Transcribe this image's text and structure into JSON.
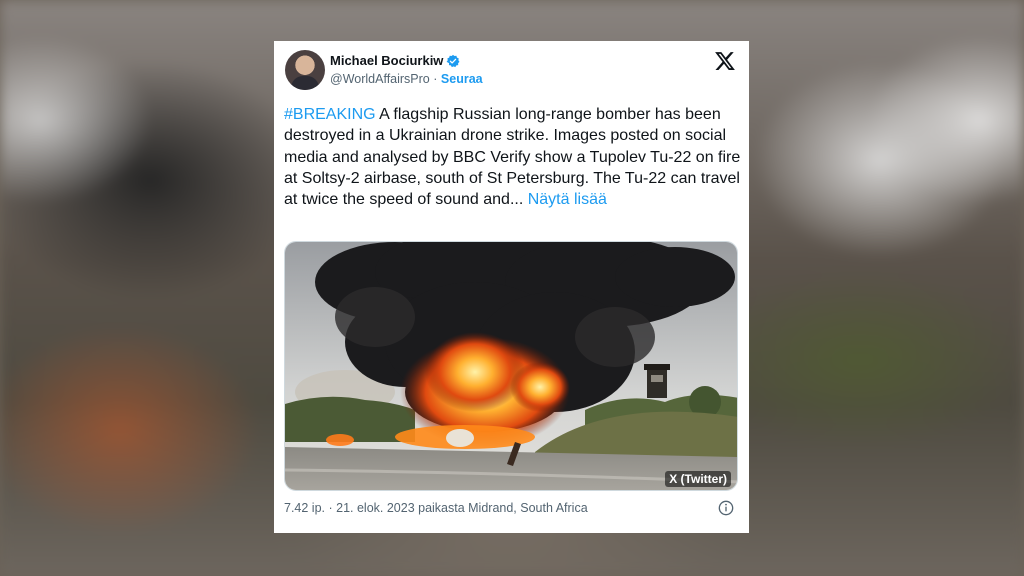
{
  "tweet": {
    "author_name": "Michael Bociurkiw",
    "handle": "@WorldAffairsPro",
    "separator": "·",
    "follow_label": "Seuraa",
    "hashtag": "#BREAKING",
    "body": " A flagship Russian long-range bomber has been destroyed in a Ukrainian drone strike. Images posted on social media and analysed by BBC Verify show a Tupolev Tu-22 on fire at Soltsy-2 airbase, south of St Petersburg. The Tu-22 can travel at twice the speed of sound and...",
    "show_more": " Näytä lisää",
    "media_credit": "X (Twitter)",
    "timestamp": "7.42 ip. · 21. elok. 2023 paikasta Midrand, South Africa"
  },
  "icons": {
    "verified": "verified-badge-icon",
    "platform": "x-logo-icon",
    "info": "info-icon"
  },
  "colors": {
    "link": "#1d9bf0",
    "text": "#0f1419",
    "muted": "#536471"
  }
}
